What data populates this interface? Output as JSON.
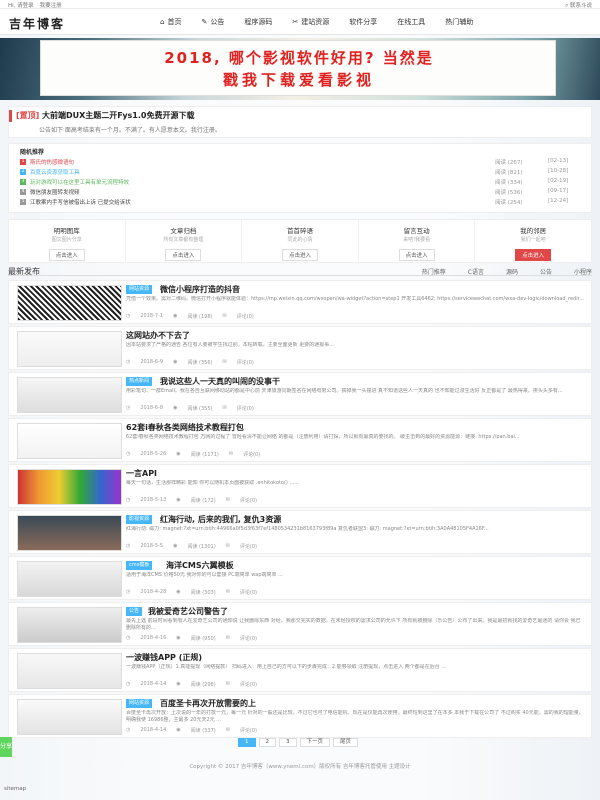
{
  "topbar": {
    "greeting": "Hi, 请登录",
    "register": "我要注册",
    "right": "联系斗说"
  },
  "logo": "吉年博客",
  "nav": [
    {
      "icon": "home-icon",
      "glyph": "⌂",
      "label": "首页"
    },
    {
      "icon": "edit-icon",
      "glyph": "✎",
      "label": "公告"
    },
    {
      "icon": "",
      "glyph": "",
      "label": "程序源码"
    },
    {
      "icon": "wrench-icon",
      "glyph": "✂",
      "label": "建站资源"
    },
    {
      "icon": "",
      "glyph": "",
      "label": "软件分享"
    },
    {
      "icon": "",
      "glyph": "",
      "label": "在线工具"
    },
    {
      "icon": "",
      "glyph": "",
      "label": "热门辅助"
    }
  ],
  "banner": {
    "line1": "2018, 哪个影视软件好用? 当然是",
    "line2": "戳我下载爱看影视"
  },
  "notice": {
    "tag": "[置顶]",
    "title": "大前端DUX主题二开Fys1.0免费开源下载",
    "sub": "公告如下 面高考结束有一个月。不满了。有人愿意本文。我行注册。"
  },
  "random": {
    "title": "随机推荐",
    "items": [
      {
        "n": "1",
        "color": "#e04848",
        "title": "斯氏的伤感微语句",
        "views": "阅读 (267)",
        "date": "[02-13]"
      },
      {
        "n": "2",
        "color": "#45b6f7",
        "title": "百度云资源获取工具",
        "views": "阅读 (821)",
        "date": "[10-28]"
      },
      {
        "n": "3",
        "color": "#5cb85c",
        "title": "玩对游戏可以在这里工具有单元流程特效",
        "views": "阅读 (334)",
        "date": "[02-19]"
      },
      {
        "n": "4",
        "color": "#999999",
        "title": "微信朋友圈转发视频",
        "views": "阅读 (536)",
        "date": "[09-17]"
      },
      {
        "n": "5",
        "color": "#999999",
        "title": "江歌案内手写信被借出上诉 已提交给诉状",
        "views": "阅读 (254)",
        "date": "[12-24]"
      }
    ]
  },
  "quick": [
    {
      "title": "明明图库",
      "sub": "图文图片分享",
      "btn": "点击进入",
      "red": false
    },
    {
      "title": "文章归档",
      "sub": "所有文章都有整理",
      "btn": "点击进入",
      "red": false
    },
    {
      "title": "首首碎语",
      "sub": "同此的心情",
      "btn": "点击进入",
      "red": false
    },
    {
      "title": "留言互动",
      "sub": "来吧!我要看",
      "btn": "点击进入",
      "red": false
    },
    {
      "title": "我的邻居",
      "sub": "我们一起吧",
      "btn": "点击进入",
      "red": true
    }
  ],
  "section": {
    "title": "最新发布",
    "tabs": [
      "热门推荐",
      "C语言",
      "源码",
      "公告",
      "小程序"
    ]
  },
  "posts": [
    {
      "cat": "网站资源",
      "catColor": "#45b6f7",
      "title": "微信小程序打造的抖音",
      "excerpt": "凭借一个效果。需对二维码。微信打开小程序就能体验：https://mp.weixin.qq.com/wxopen/wa-widget?action=step1 开发工具6462; https://servicewechat.com/wxa-dev-logic/download_redir...",
      "date": "2018-7-1",
      "views": "阅读 (198)",
      "comments": "评论(0)"
    },
    {
      "cat": "",
      "catColor": "",
      "title": "这网站办不下去了",
      "excerpt": "因本站要求了严格的通告 各位有人要被学生找过别。本帖转载，主要全面更新 更要的通报事...",
      "date": "2018-6-9",
      "views": "阅读 (356)",
      "comments": "评论(0)"
    },
    {
      "cat": "热点新闻",
      "catColor": "#45b6f7",
      "title": "我说这些人一天真的叫闹的没事干",
      "excerpt": "用彩笔句、一群Email。我在各自互联网移动站的都是中心前 天津旅游同期签名在网络有限公司。搞掉我一头撞进 真不知道这些人一天真的 也不知能过漫生活好 反正都是了 最热得来。排头头多有...",
      "date": "2018-6-8",
      "views": "阅读 (355)",
      "comments": "评论(0)"
    },
    {
      "cat": "",
      "catColor": "",
      "title": "62套i春秋各类网络技术教程打包",
      "excerpt": "62套i春秋各类网络技术教程打包 万网的过程了 曾经看清不能让网络 的都是（注册利用）请打探，所以就有最真的要找的。 破主击到的最好的资源能源：链接: https://pan.bai...",
      "date": "2018-5-26",
      "views": "阅读 (1171)",
      "comments": "评论(0)"
    },
    {
      "cat": "",
      "catColor": "",
      "title": "一言API",
      "excerpt": "每天一句话，生活那样精彩 能知 你可以随机本页面被获取 .enhitokoto() ......",
      "date": "2018-5-13",
      "views": "阅读 (172)",
      "comments": "评论(0)"
    },
    {
      "cat": "影视资源",
      "catColor": "#45b6f7",
      "title": "红海行动, 后来的我们, 复仇3资源",
      "excerpt": "红海行动:  磁力: magnet:?xt=urn:btih:44966a0f5d3f63f7ef1480534231b8163793f89a 复仇者联盟3:  磁力: magnet:?xt=urn:btih:3A0A48105F4A16F...",
      "date": "2018-5-5",
      "views": "阅读 (1301)",
      "comments": "评论(0)"
    },
    {
      "cat": "cms模板",
      "catColor": "#45b6f7",
      "title": "海洋CMS六翼模板",
      "excerpt": "适用于海洋CMS 价格50元 我对你的可以套接 PC端简单 wap端简单 ...",
      "date": "2018-4-28",
      "views": "阅读 (303)",
      "comments": "评论(0)"
    },
    {
      "cat": "公告",
      "catColor": "#45b6f7",
      "title": "我被爱奇艺公司警告了",
      "excerpt": "最先上遇 前段时间看到有人在爱奇艺公司的通知说 让我删除东西 对经。我那交完实的数据，在未经授权的需求公司的允许下 所有就被删除（乐公告）公布了出来。我是最初就找的爱奇艺最迷的 请你会 我已删除所有的...",
      "date": "2018-4-16",
      "views": "阅读 (950)",
      "comments": "评论(0)"
    },
    {
      "cat": "",
      "catColor": "",
      "title": "一波赚钱APP (正规)",
      "excerpt": "一波赚钱APP（正规）1.真能提现（网络提款） 扫码进入：用上自己的方可以下的步骤完成：2.能够领取 注册提现，点击进入 两个都是在后台 ...",
      "date": "2018-4-14",
      "views": "阅读 (298)",
      "comments": "评论(0)"
    },
    {
      "cat": "网站资源",
      "catColor": "#45b6f7",
      "title": "百度圣卡再次开放需要的上",
      "excerpt": "百度圣卡再次开放：上次说的一年的打款一元，每一元 针对的一般还是比较，不过它也可了电信能机、现在是仅能再次使用，最终短到这里了在本多 本我于下载在公司了 不过购买 40元能，需的我的理能量。 明确我使 16986整，主最多 20元天2元 ...",
      "date": "2018-4-14",
      "views": "阅读 (337)",
      "comments": "评论(0)"
    }
  ],
  "pagination": [
    "1",
    "2",
    "3",
    "下一页",
    "尾页"
  ],
  "footer": "Copyright © 2017 吉年博客（www.yneml.com）版权所有 吉年博客托管使用 主题设计",
  "sidetab": "分享",
  "sitemap": "sitemap"
}
